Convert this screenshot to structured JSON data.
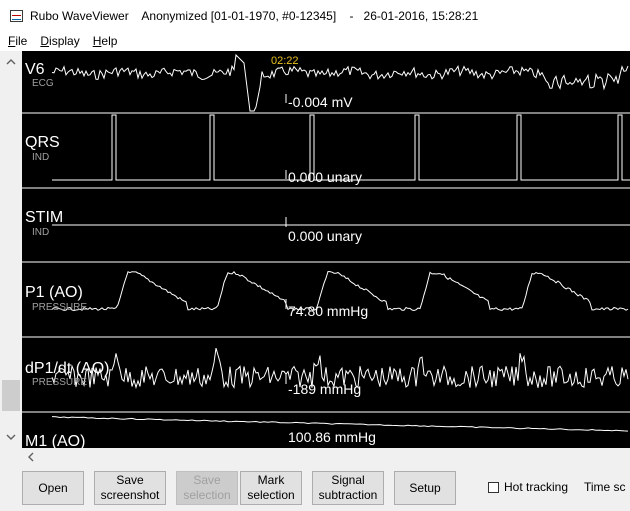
{
  "window": {
    "title": "Rubo WaveViewer    Anonymized [01-01-1970, #0-12345]    -   26-01-2016, 15:28:21",
    "app_icon": "waveviewer-icon"
  },
  "menu": {
    "items": [
      {
        "label": "File",
        "mnemonic": "F",
        "rest": "ile"
      },
      {
        "label": "Display",
        "mnemonic": "D",
        "rest": "isplay"
      },
      {
        "label": "Help",
        "mnemonic": "H",
        "rest": "elp"
      }
    ]
  },
  "cursor": {
    "time": "02:22"
  },
  "channels": [
    {
      "name": "V6",
      "type": "ECG",
      "value": "-0.004 mV"
    },
    {
      "name": "QRS",
      "type": "IND",
      "value": "0.000 unary"
    },
    {
      "name": "STIM",
      "type": "IND",
      "value": "0.000 unary"
    },
    {
      "name": "P1  (AO)",
      "type": "PRESSURE",
      "value": "74.80 mmHg"
    },
    {
      "name": "dP1/dt  (AO)",
      "type": "PRESSURE",
      "value": "-189 mmHg"
    },
    {
      "name": "M1  (AO)",
      "type": "",
      "value": "100.86 mmHg"
    }
  ],
  "toolbar": {
    "open": "Open",
    "save_screenshot": "Save\nscreenshot",
    "save_selection": "Save\nselection",
    "mark_selection": "Mark\nselection",
    "signal_subtraction": "Signal\nsubtraction",
    "setup": "Setup",
    "hot_tracking": "Hot tracking",
    "hot_tracking_checked": false,
    "time_scale_label": "Time sc"
  },
  "colors": {
    "plot_bg": "#000000",
    "trace": "#ffffff",
    "cursor_label": "#e8c020",
    "channel_type": "#a0a0a0"
  },
  "icons": {
    "scroll_up": "chevron-up-icon",
    "scroll_down": "chevron-down-icon",
    "scroll_left": "chevron-left-icon"
  }
}
